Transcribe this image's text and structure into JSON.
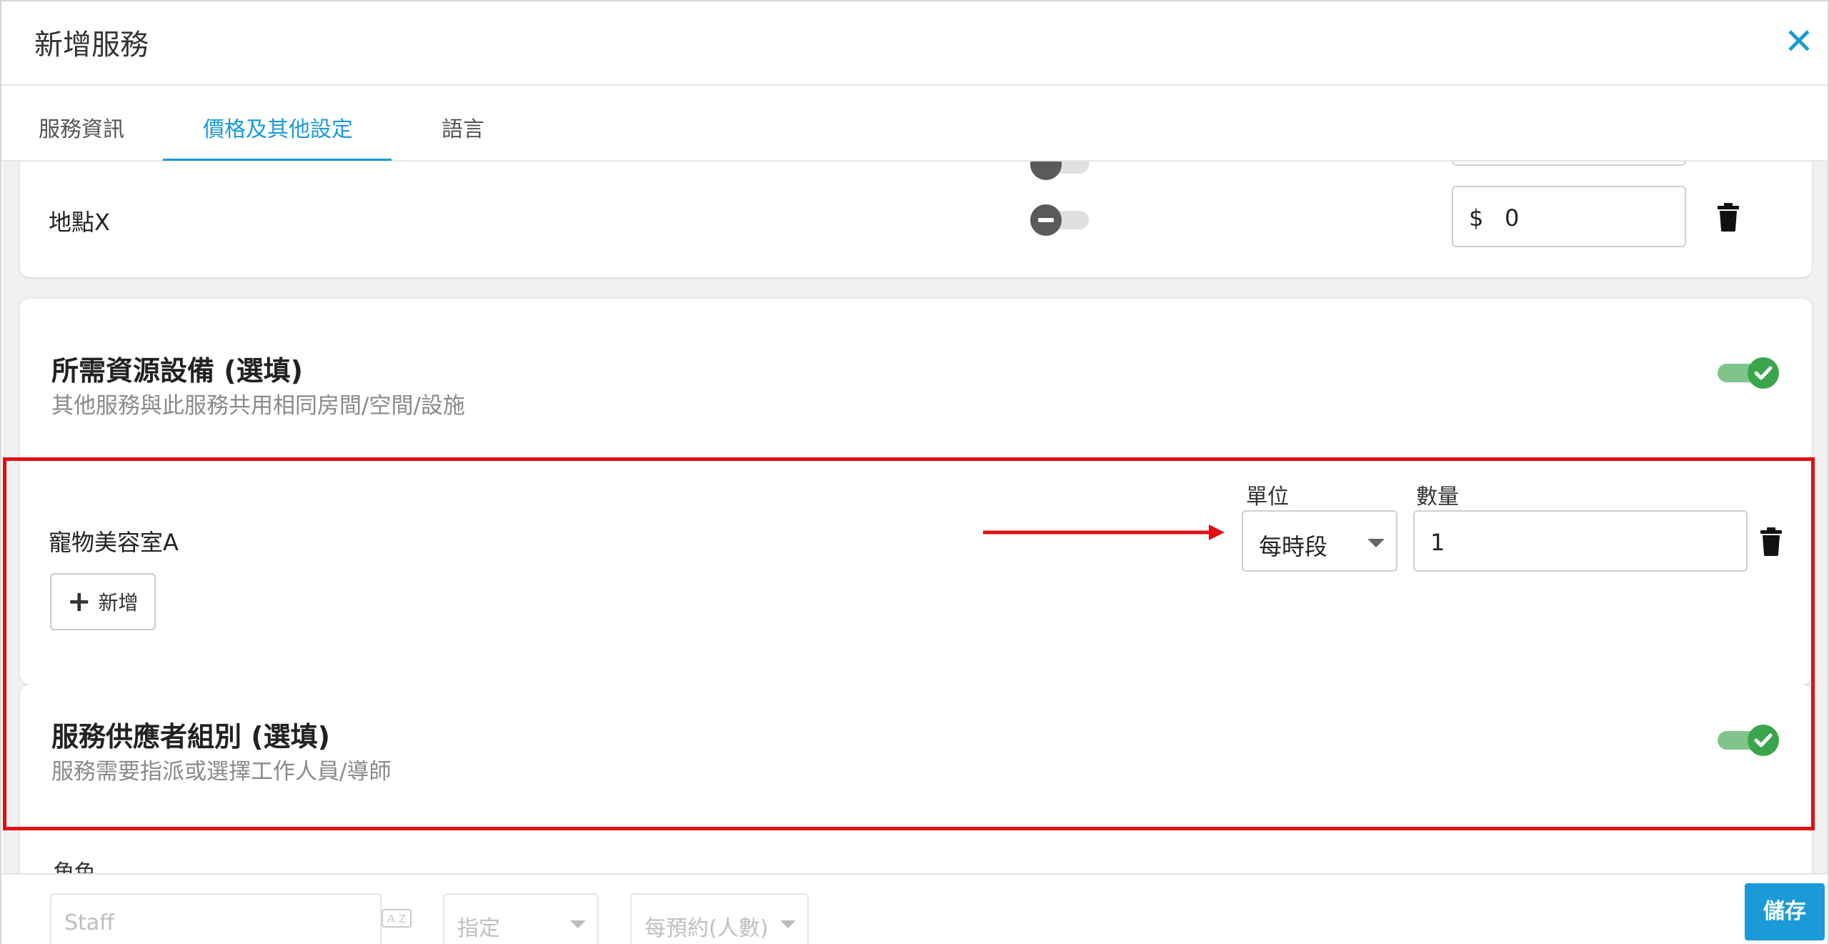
{
  "header": {
    "title": "新增服務",
    "close_label": "✕"
  },
  "tabs": [
    {
      "label": "服務資訊"
    },
    {
      "label": "價格及其他設定"
    },
    {
      "label": "語言"
    }
  ],
  "location_row": {
    "label": "地點X",
    "currency": "$",
    "price": "0"
  },
  "resource_section": {
    "title": "所需資源設備 (選填)",
    "subtitle": "其他服務與此服務共用相同房間/空間/設施",
    "unit_label": "單位",
    "quantity_label": "數量",
    "item_label": "寵物美容室A",
    "unit_value": "每時段",
    "quantity_value": "1",
    "add_label": "新增"
  },
  "provider_section": {
    "title": "服務供應者組別 (選填)",
    "subtitle": "服務需要指派或選擇工作人員/導師",
    "role_label": "角色",
    "role_placeholder": "Staff",
    "assign_value": "指定",
    "per_value": "每預約(人數)"
  },
  "footer": {
    "save_label": "儲存"
  },
  "colors": {
    "accent": "#1a9bd7",
    "toggle_on": "#3aa54b",
    "highlight": "#e10f12"
  }
}
